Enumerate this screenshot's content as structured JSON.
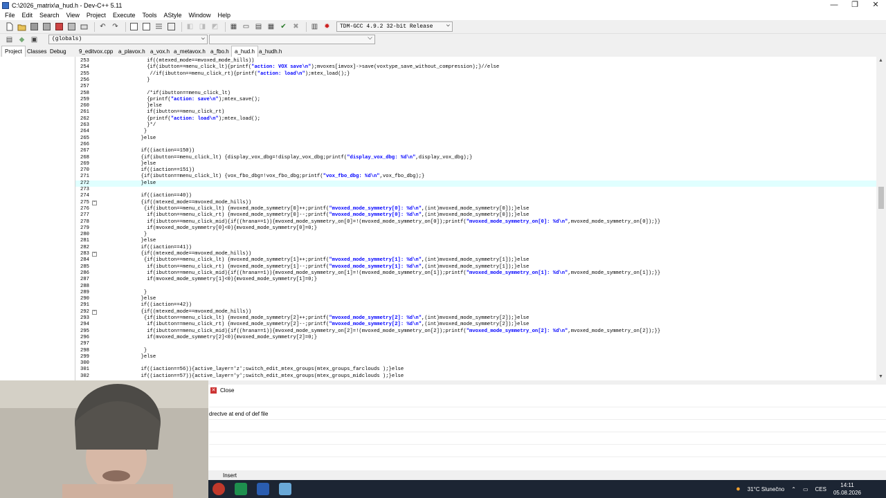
{
  "window": {
    "title": "C:\\2026_matrix\\a_hud.h - Dev-C++ 5.11",
    "minimize": "—",
    "maximize": "❐",
    "close": "✕"
  },
  "menu": [
    "File",
    "Edit",
    "Search",
    "View",
    "Project",
    "Execute",
    "Tools",
    "AStyle",
    "Window",
    "Help"
  ],
  "toolbar": {
    "compiler": "TDM-GCC 4.9.2 32-bit Release",
    "globals": "(globals)"
  },
  "left_tabs": [
    "Project",
    "Classes",
    "Debug"
  ],
  "file_tabs": [
    {
      "label": "9_editvox.cpp",
      "active": false
    },
    {
      "label": "a_plavox.h",
      "active": false
    },
    {
      "label": "a_vox.h",
      "active": false
    },
    {
      "label": "a_metavox.h",
      "active": false
    },
    {
      "label": "a_fbo.h",
      "active": false
    },
    {
      "label": "a_hud.h",
      "active": true
    },
    {
      "label": "a_hudh.h",
      "active": false
    }
  ],
  "editor": {
    "current_line": 272,
    "lines": [
      {
        "n": "253",
        "fold": "",
        "text": "       if((mtexed_mode==mvoxed_mode_hills))"
      },
      {
        "n": "254",
        "fold": "",
        "text": "       {if(ibutton==menu_click_lt){printf(\"action: VOX save\\n\");mvoxes[imvox]->save(voxtype_save_without_compression);}//else"
      },
      {
        "n": "255",
        "fold": "",
        "text": "        //if(ibutton==menu_click_rt){printf(\"action: load\\n\");mtex_load();}"
      },
      {
        "n": "256",
        "fold": "",
        "text": "       }"
      },
      {
        "n": "257",
        "fold": "",
        "text": ""
      },
      {
        "n": "258",
        "fold": "",
        "text": "       /*if(ibutton==menu_click_lt)"
      },
      {
        "n": "259",
        "fold": "",
        "text": "       {printf(\"action: save\\n\");mtex_save();"
      },
      {
        "n": "260",
        "fold": "",
        "text": "       }else"
      },
      {
        "n": "261",
        "fold": "",
        "text": "       if(ibutton==menu_click_rt)"
      },
      {
        "n": "262",
        "fold": "",
        "text": "       {printf(\"action: load\\n\");mtex_load();"
      },
      {
        "n": "263",
        "fold": "",
        "text": "       }*/"
      },
      {
        "n": "264",
        "fold": "",
        "text": "      }"
      },
      {
        "n": "265",
        "fold": "",
        "text": "     }else"
      },
      {
        "n": "266",
        "fold": "",
        "text": ""
      },
      {
        "n": "267",
        "fold": "",
        "text": "     if((iaction==150))"
      },
      {
        "n": "268",
        "fold": "",
        "text": "     {if(ibutton==menu_click_lt) {display_vox_dbg=!display_vox_dbg;printf(\"display_vox_dbg: %d\\n\",display_vox_dbg);}"
      },
      {
        "n": "269",
        "fold": "",
        "text": "     }else"
      },
      {
        "n": "270",
        "fold": "",
        "text": "     if((iaction==151))"
      },
      {
        "n": "271",
        "fold": "",
        "text": "     {if(ibutton==menu_click_lt) {vox_fbo_dbg=!vox_fbo_dbg;printf(\"vox_fbo_dbg: %d\\n\",vox_fbo_dbg);}"
      },
      {
        "n": "272",
        "fold": "",
        "text": "     }else"
      },
      {
        "n": "273",
        "fold": "",
        "text": ""
      },
      {
        "n": "274",
        "fold": "",
        "text": "     if((iaction==40))"
      },
      {
        "n": "275",
        "fold": "−",
        "text": "     {if((mtexed_mode==mvoxed_mode_hills))"
      },
      {
        "n": "276",
        "fold": "",
        "text": "      {if(ibutton==menu_click_lt) {mvoxed_mode_symmetry[0]++;printf(\"mvoxed_mode_symmetry[0]: %d\\n\",(int)mvoxed_mode_symmetry[0]);}else"
      },
      {
        "n": "277",
        "fold": "",
        "text": "       if(ibutton==menu_click_rt) {mvoxed_mode_symmetry[0]--;printf(\"mvoxed_mode_symmetry[0]: %d\\n\",(int)mvoxed_mode_symmetry[0]);}else"
      },
      {
        "n": "278",
        "fold": "",
        "text": "       if(ibutton==menu_click_mid){if((hrana==1)){mvoxed_mode_symmetry_on[0]=!(mvoxed_mode_symmetry_on[0]);printf(\"mvoxed_mode_symmetry_on[0]: %d\\n\",mvoxed_mode_symmetry_on[0]);}}"
      },
      {
        "n": "279",
        "fold": "",
        "text": "       if(mvoxed_mode_symmetry[0]<0){mvoxed_mode_symmetry[0]=0;}"
      },
      {
        "n": "280",
        "fold": "",
        "text": "      }"
      },
      {
        "n": "281",
        "fold": "",
        "text": "     }else"
      },
      {
        "n": "282",
        "fold": "",
        "text": "     if((iaction==41))"
      },
      {
        "n": "283",
        "fold": "−",
        "text": "     {if((mtexed_mode==mvoxed_mode_hills))"
      },
      {
        "n": "284",
        "fold": "",
        "text": "      {if(ibutton==menu_click_lt) {mvoxed_mode_symmetry[1]++;printf(\"mvoxed_mode_symmetry[1]: %d\\n\",(int)mvoxed_mode_symmetry[1]);}else"
      },
      {
        "n": "285",
        "fold": "",
        "text": "       if(ibutton==menu_click_rt) {mvoxed_mode_symmetry[1]--;printf(\"mvoxed_mode_symmetry[1]: %d\\n\",(int)mvoxed_mode_symmetry[1]);}else"
      },
      {
        "n": "286",
        "fold": "",
        "text": "       if(ibutton==menu_click_mid){if((hrana==1)){mvoxed_mode_symmetry_on[1]=!(mvoxed_mode_symmetry_on[1]);printf(\"mvoxed_mode_symmetry_on[1]: %d\\n\",mvoxed_mode_symmetry_on[1]);}}"
      },
      {
        "n": "287",
        "fold": "",
        "text": "       if(mvoxed_mode_symmetry[1]<0){mvoxed_mode_symmetry[1]=0;}"
      },
      {
        "n": "288",
        "fold": "",
        "text": ""
      },
      {
        "n": "289",
        "fold": "",
        "text": "      }"
      },
      {
        "n": "290",
        "fold": "",
        "text": "     }else"
      },
      {
        "n": "291",
        "fold": "",
        "text": "     if((iaction==42))"
      },
      {
        "n": "292",
        "fold": "−",
        "text": "     {if((mtexed_mode==mvoxed_mode_hills))"
      },
      {
        "n": "293",
        "fold": "",
        "text": "      {if(ibutton==menu_click_lt) {mvoxed_mode_symmetry[2]++;printf(\"mvoxed_mode_symmetry[2]: %d\\n\",(int)mvoxed_mode_symmetry[2]);}else"
      },
      {
        "n": "294",
        "fold": "",
        "text": "       if(ibutton==menu_click_rt) {mvoxed_mode_symmetry[2]--;printf(\"mvoxed_mode_symmetry[2]: %d\\n\",(int)mvoxed_mode_symmetry[2]);}else"
      },
      {
        "n": "295",
        "fold": "",
        "text": "       if(ibutton==menu_click_mid){if((hrana==1)){mvoxed_mode_symmetry_on[2]=!(mvoxed_mode_symmetry_on[2]);printf(\"mvoxed_mode_symmetry_on[2]: %d\\n\",mvoxed_mode_symmetry_on[2]);}}"
      },
      {
        "n": "296",
        "fold": "",
        "text": "       if(mvoxed_mode_symmetry[2]<0){mvoxed_mode_symmetry[2]=0;}"
      },
      {
        "n": "297",
        "fold": "",
        "text": ""
      },
      {
        "n": "298",
        "fold": "",
        "text": "      }"
      },
      {
        "n": "299",
        "fold": "",
        "text": "     }else"
      },
      {
        "n": "300",
        "fold": "",
        "text": ""
      },
      {
        "n": "301",
        "fold": "",
        "text": "     if((iaction==56)){active_layer='z';switch_edit_mtex_groups(mtex_groups_farclouds );}else"
      },
      {
        "n": "302",
        "fold": "",
        "text": "     if((iaction==57)){active_layer='y';switch_edit_mtex_groups(mtex_groups_midclouds );}else"
      }
    ]
  },
  "bottom": {
    "close_label": "Close",
    "message": "drectve at end of def file"
  },
  "status": {
    "mode": "Insert"
  },
  "tray": {
    "weather": "31°C  Slunečno",
    "lang": "CES",
    "time": "14:11",
    "date": "05.08.2026"
  },
  "colors": {
    "current_line": "#e0ffff",
    "string": "#0000ff",
    "taskbar": "#1c2533"
  }
}
